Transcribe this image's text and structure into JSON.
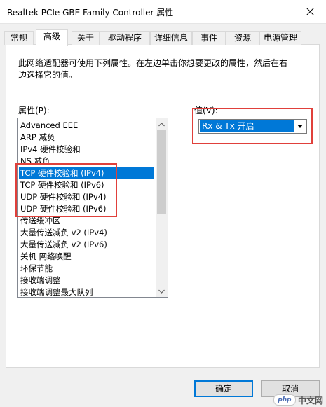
{
  "window": {
    "title": "Realtek PCIe GBE Family Controller 属性",
    "close_icon": "close-icon"
  },
  "tabs": [
    {
      "label": "常规",
      "active": false
    },
    {
      "label": "高级",
      "active": true
    },
    {
      "label": "关于",
      "active": false
    },
    {
      "label": "驱动程序",
      "active": false
    },
    {
      "label": "详细信息",
      "active": false
    },
    {
      "label": "事件",
      "active": false
    },
    {
      "label": "资源",
      "active": false
    },
    {
      "label": "电源管理",
      "active": false
    }
  ],
  "advanced": {
    "description": "此网络适配器可使用下列属性。在左边单击你想要更改的属性，然后在右边选择它的值。",
    "property_label": "属性(P):",
    "value_label": "值(V):",
    "properties": [
      "Advanced EEE",
      "ARP 减负",
      "IPv4 硬件校验和",
      "NS 减负",
      "TCP 硬件校验和 (IPv4)",
      "TCP 硬件校验和 (IPv6)",
      "UDP 硬件校验和 (IPv4)",
      "UDP 硬件校验和 (IPv6)",
      "传送缓冲区",
      "大量传送减负 v2 (IPv4)",
      "大量传送减负 v2 (IPv6)",
      "关机 网络唤醒",
      "环保节能",
      "接收端调整",
      "接收端调整最大队列"
    ],
    "selected_index": 4,
    "value_selected": "Rx & Tx 开启"
  },
  "buttons": {
    "ok": "确定",
    "cancel": "取消"
  },
  "watermark": {
    "logo": "php",
    "text": "中文网"
  },
  "colors": {
    "selection": "#0078d7",
    "highlight_box": "#e0403b",
    "window_bg": "#f0f0f0"
  }
}
